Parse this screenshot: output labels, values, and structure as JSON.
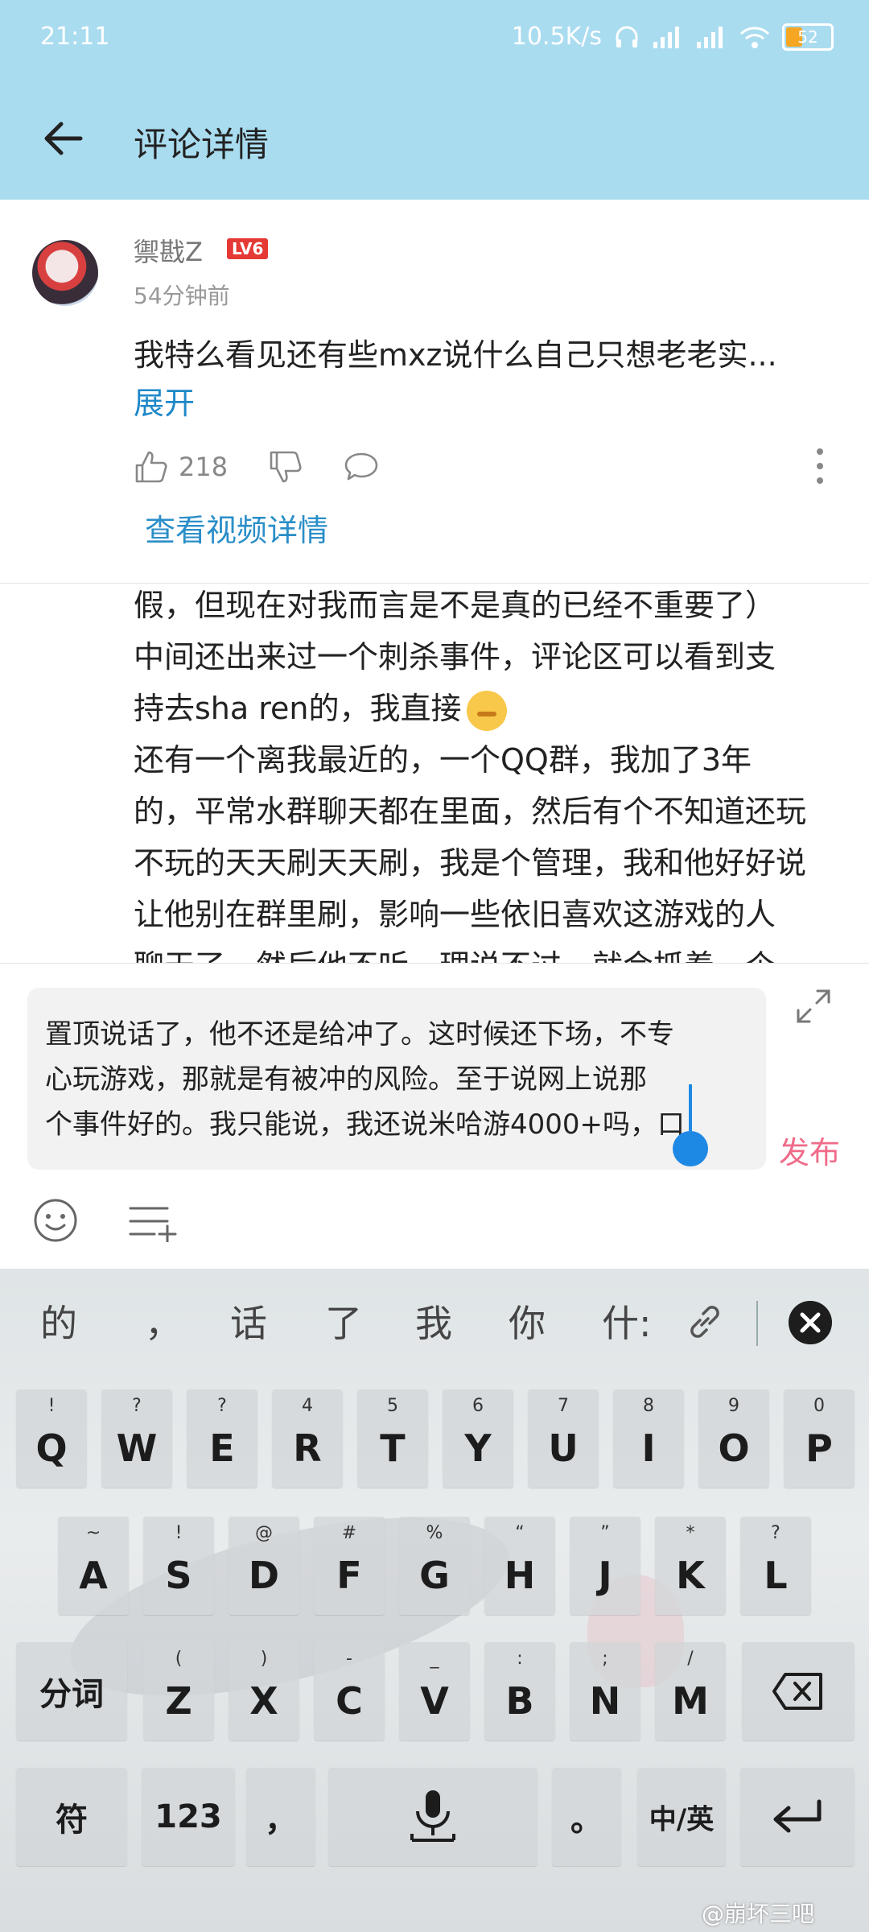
{
  "status_bar": {
    "time": "21:11",
    "net_speed": "10.5K/s",
    "battery": "52"
  },
  "header": {
    "title": "评论详情"
  },
  "comment": {
    "username": "禦戡Z",
    "level": "LV6",
    "time_ago": "54分钟前",
    "text": "我特么看见还有些mxz说什么自己只想老老实...",
    "expand_label": "展开",
    "like_count": "218",
    "video_link": "查看视频详情"
  },
  "reply_lines": [
    "假，但现在对我而言是不是真的已经不重要了）",
    "中间还出来过一个刺杀事件，评论区可以看到支",
    "持去sha ren的，我直接",
    "还有一个离我最近的，一个QQ群，我加了3年",
    "的，平常水群聊天都在里面，然后有个不知道还玩",
    "不玩的天天刷天天刷，我是个管理，我和他好好说",
    "让他别在群里刷，影响一些依旧喜欢这游戏的人",
    "聊天了，然后他不听，理说不过，就会抓着一个"
  ],
  "compose": {
    "lines": [
      "置顶说话了，他不还是给冲了。这时候还下场，不专",
      "心玩游戏，那就是有被冲的风险。至于说网上说那",
      "个事件好的。我只能说，我还说米哈游4000+吗，口"
    ],
    "publish_label": "发布"
  },
  "keyboard": {
    "candidates": [
      "的",
      "，",
      "话",
      "了",
      "我",
      "你",
      "什:"
    ],
    "row1": [
      {
        "main": "Q",
        "sub": "!"
      },
      {
        "main": "W",
        "sub": "?"
      },
      {
        "main": "E",
        "sub": "?"
      },
      {
        "main": "R",
        "sub": "4"
      },
      {
        "main": "T",
        "sub": "5"
      },
      {
        "main": "Y",
        "sub": "6"
      },
      {
        "main": "U",
        "sub": "7"
      },
      {
        "main": "I",
        "sub": "8"
      },
      {
        "main": "O",
        "sub": "9"
      },
      {
        "main": "P",
        "sub": "0"
      }
    ],
    "row2": [
      {
        "main": "A",
        "sub": "~"
      },
      {
        "main": "S",
        "sub": "!"
      },
      {
        "main": "D",
        "sub": "@"
      },
      {
        "main": "F",
        "sub": "#"
      },
      {
        "main": "G",
        "sub": "%"
      },
      {
        "main": "H",
        "sub": "“"
      },
      {
        "main": "J",
        "sub": "”"
      },
      {
        "main": "K",
        "sub": "*"
      },
      {
        "main": "L",
        "sub": "?"
      }
    ],
    "row3_left": "分词",
    "row3": [
      {
        "main": "Z",
        "sub": "("
      },
      {
        "main": "X",
        "sub": ")"
      },
      {
        "main": "C",
        "sub": "-"
      },
      {
        "main": "V",
        "sub": "_"
      },
      {
        "main": "B",
        "sub": ":"
      },
      {
        "main": "N",
        "sub": ";"
      },
      {
        "main": "M",
        "sub": "/"
      }
    ],
    "symbol_key": "符",
    "num_key": "123",
    "comma_key": "，",
    "period_key": "。",
    "lang_key": "中/英"
  },
  "watermark": "@崩坏三吧"
}
